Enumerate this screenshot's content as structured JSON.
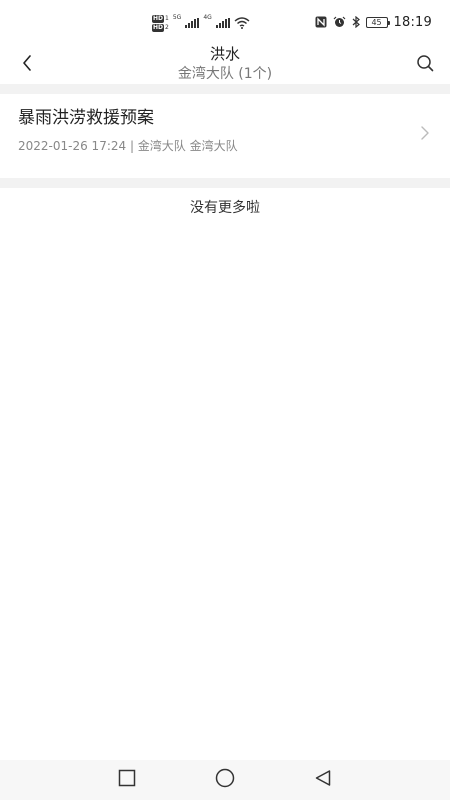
{
  "status_bar": {
    "sim1_badge": "HD",
    "sim1_num": "1",
    "sim2_badge": "HD",
    "sim2_num": "2",
    "net1": "5G",
    "net2": "4G",
    "battery": "45",
    "time": "18:19"
  },
  "header": {
    "title": "洪水",
    "subtitle": "金湾大队 (1个)"
  },
  "list": {
    "items": [
      {
        "title": "暴雨洪涝救援预案",
        "meta": "2022-01-26 17:24 | 金湾大队 金湾大队"
      }
    ],
    "end_text": "没有更多啦"
  },
  "icons": {
    "back": "chevron-left-icon",
    "search": "search-icon",
    "item_chevron": "chevron-right-icon",
    "nav_recent": "square-icon",
    "nav_home": "circle-icon",
    "nav_back": "triangle-back-icon"
  }
}
